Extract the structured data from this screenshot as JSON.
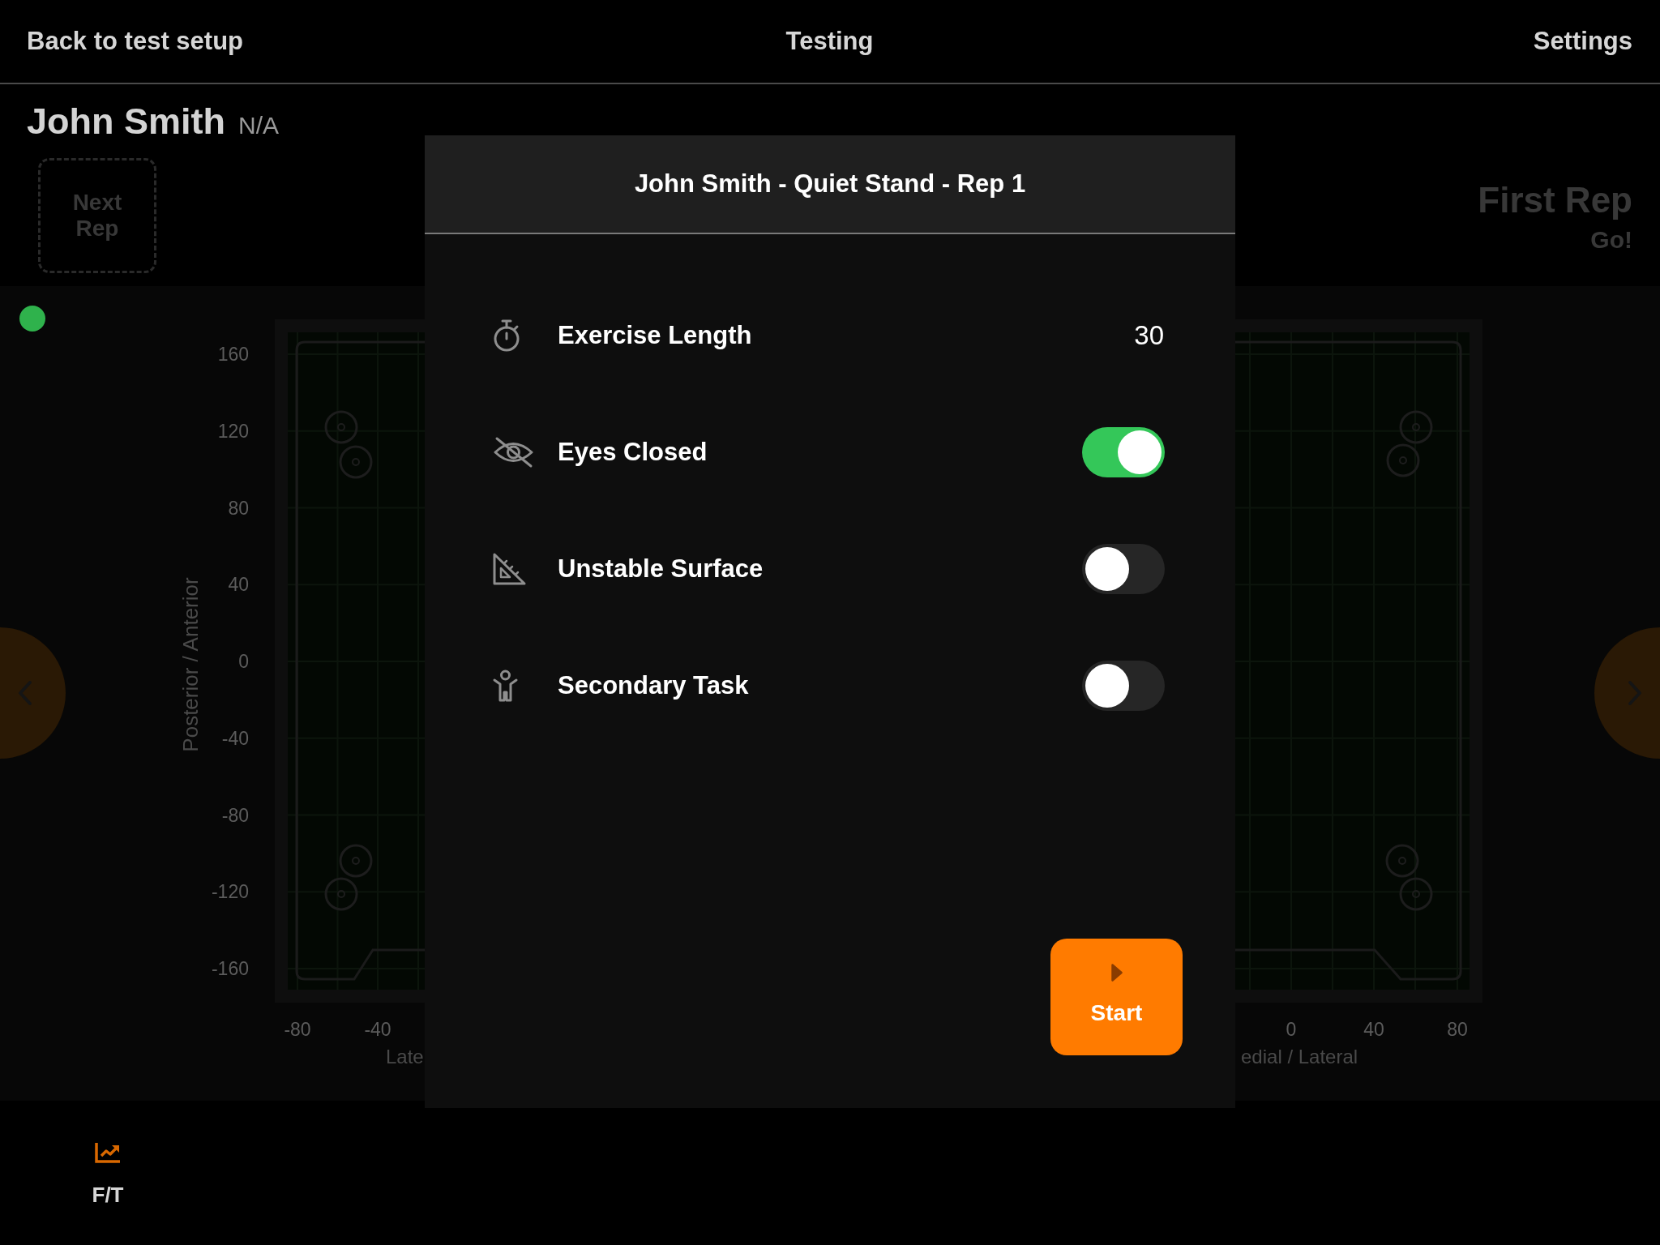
{
  "header": {
    "back_link": "Back to test setup",
    "title": "Testing",
    "settings_link": "Settings"
  },
  "subject": {
    "name": "John Smith",
    "id": "N/A"
  },
  "next_rep_button": {
    "label": "Next Rep",
    "disabled": true
  },
  "rep_status": {
    "title": "First Rep",
    "subtitle": "Go!"
  },
  "status_indicator": {
    "on": true
  },
  "plot": {
    "y_label": "Posterior / Anterior",
    "y_ticks": [
      "160",
      "120",
      "80",
      "40",
      "0",
      "-40",
      "-80",
      "-120",
      "-160"
    ],
    "left_x_ticks": [
      "-80",
      "-40"
    ],
    "left_x_label": "Late",
    "right_x_ticks": [
      "0",
      "40",
      "80"
    ],
    "right_x_label": "edial / Lateral"
  },
  "dialog": {
    "title": "John Smith - Quiet Stand - Rep 1",
    "options": [
      {
        "kind": "value",
        "label": "Exercise Length",
        "value": "30"
      },
      {
        "kind": "toggle",
        "label": "Eyes Closed",
        "on": true
      },
      {
        "kind": "toggle",
        "label": "Unstable Surface",
        "on": false
      },
      {
        "kind": "toggle",
        "label": "Secondary Task",
        "on": false
      }
    ],
    "start_button": {
      "label": "Start"
    }
  },
  "tab_bar": [
    {
      "label": "F/T",
      "selected": true
    }
  ]
}
